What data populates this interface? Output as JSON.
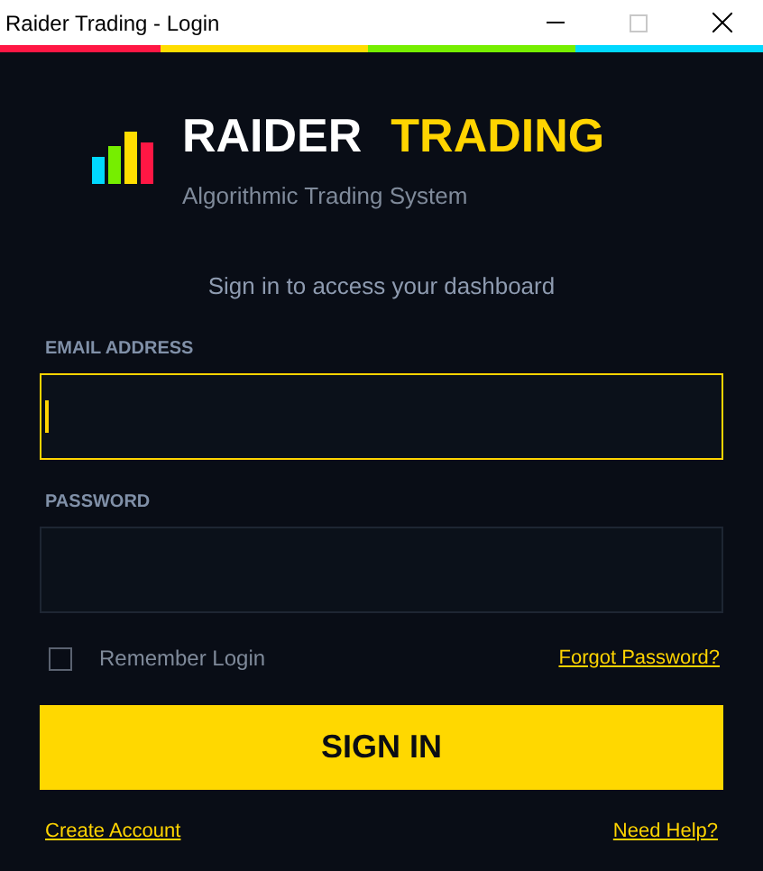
{
  "window": {
    "title": "Raider Trading - Login"
  },
  "accent_strip": [
    {
      "color": "#ff1744"
    },
    {
      "color": "#ffdd00"
    },
    {
      "color": "#76ee00"
    },
    {
      "color": "#00d8ff"
    }
  ],
  "brand": {
    "name_first": "RAIDER",
    "name_second": "TRADING",
    "tagline": "Algorithmic Trading System"
  },
  "prompt": "Sign in to access your dashboard",
  "fields": [
    {
      "label": "EMAIL ADDRESS",
      "focused": true
    },
    {
      "label": "PASSWORD",
      "focused": false
    }
  ],
  "remember": {
    "label": "Remember Login",
    "checked": false
  },
  "forgot_link": "Forgot Password?",
  "sign_in_button": "SIGN IN",
  "footer_links": [
    "Create Account",
    "Need Help?"
  ]
}
